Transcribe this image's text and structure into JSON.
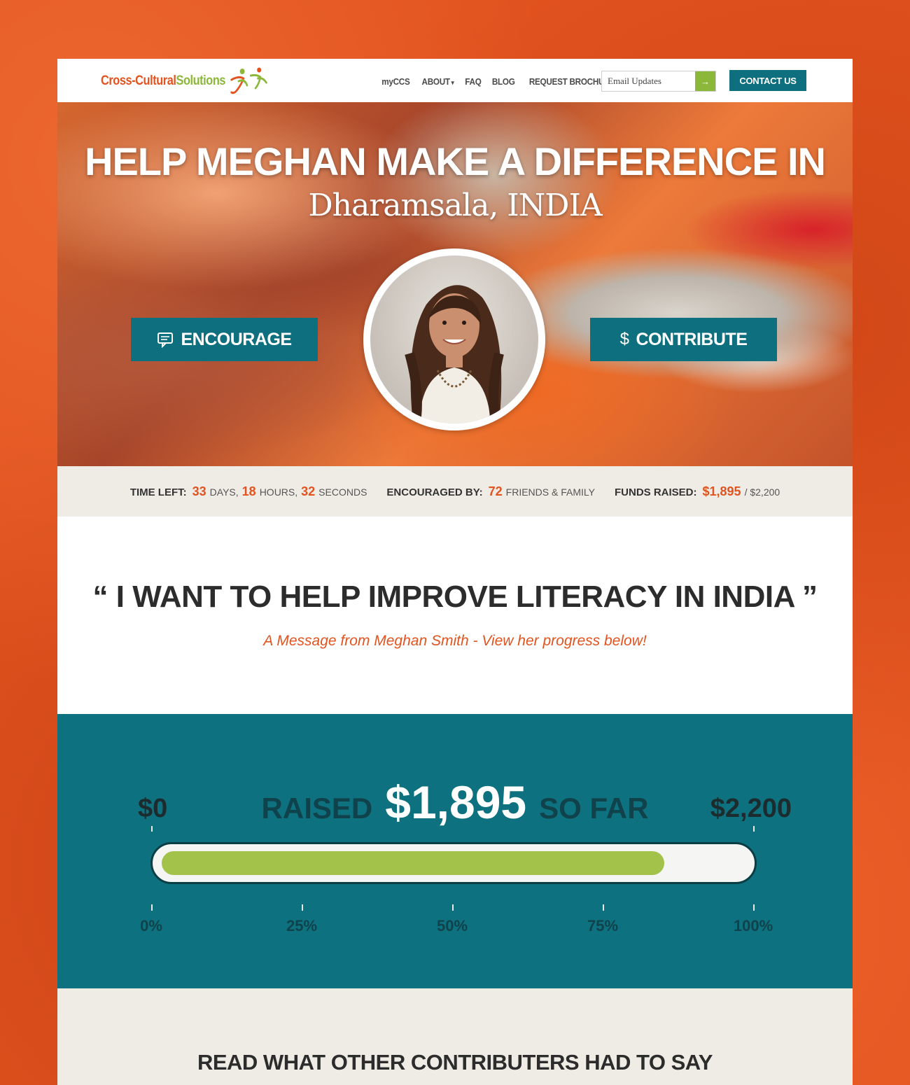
{
  "header": {
    "logo_part1": "Cross-Cultural",
    "logo_part2": "Solutions",
    "nav": [
      "myCCS",
      "ABOUT",
      "FAQ",
      "BLOG",
      "REQUEST BROCHURE"
    ],
    "email_placeholder": "Email Updates",
    "email_go_icon": "→",
    "contact_label": "CONTACT US"
  },
  "hero": {
    "title": "HELP MEGHAN MAKE A DIFFERENCE IN",
    "location": "Dharamsala, INDIA",
    "encourage_label": "ENCOURAGE",
    "contribute_label": "CONTRIBUTE",
    "contribute_icon": "$"
  },
  "stats": {
    "time_label": "TIME LEFT:",
    "days": "33",
    "days_unit": "DAYS,",
    "hours": "18",
    "hours_unit": "HOURS,",
    "seconds": "32",
    "seconds_unit": "SECONDS",
    "encouraged_label": "ENCOURAGED BY:",
    "encouraged_count": "72",
    "encouraged_unit": "FRIENDS & FAMILY",
    "funds_label": "FUNDS RAISED:",
    "funds_raised": "$1,895",
    "funds_goal": "/ $2,200"
  },
  "quote": {
    "text": "“ I WANT TO HELP IMPROVE LITERACY IN INDIA ”",
    "byline": "A Message from Meghan Smith - View her progress below!"
  },
  "progress": {
    "min_label": "$0",
    "max_label": "$2,200",
    "raised_label": "RAISED",
    "amount": "$1,895",
    "so_far": "SO FAR",
    "fraction": 0.861,
    "pct_labels": [
      "0%",
      "25%",
      "50%",
      "75%",
      "100%"
    ]
  },
  "bottom": {
    "title": "READ WHAT OTHER CONTRIBUTERS HAD TO SAY"
  },
  "colors": {
    "brand_orange": "#e2531f",
    "brand_green": "#8cb83a",
    "teal": "#0e717f",
    "progress_fill": "#a3c24a"
  }
}
